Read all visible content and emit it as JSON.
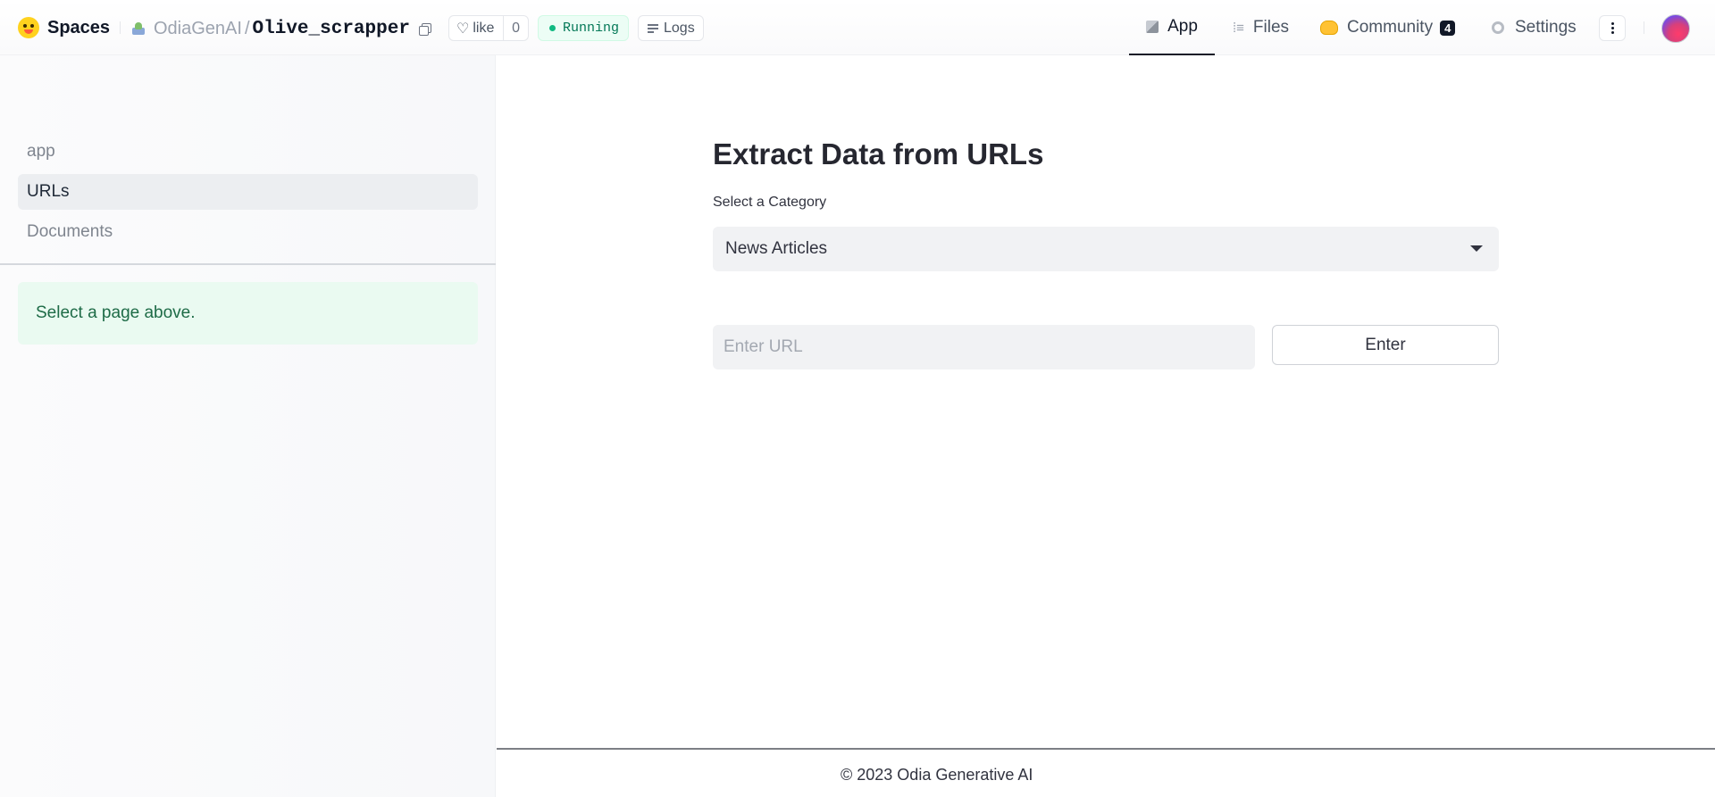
{
  "header": {
    "brand": "Spaces",
    "org": "OdiaGenAI",
    "separator": "/",
    "repo": "Olive_scrapper",
    "like_label": "like",
    "like_count": "0",
    "status": "Running",
    "logs_label": "Logs",
    "tabs": [
      {
        "label": "App",
        "icon": "cube-icon",
        "active": true
      },
      {
        "label": "Files",
        "icon": "files-icon",
        "active": false
      },
      {
        "label": "Community",
        "icon": "hands-icon",
        "badge": "4",
        "active": false
      },
      {
        "label": "Settings",
        "icon": "gear-icon",
        "active": false
      }
    ]
  },
  "sidebar": {
    "items": [
      {
        "label": "app",
        "active": false
      },
      {
        "label": "URLs",
        "active": true
      },
      {
        "label": "Documents",
        "active": false
      }
    ],
    "info": "Select a page above."
  },
  "main": {
    "title": "Extract Data from URLs",
    "category_label": "Select a Category",
    "category_selected": "News Articles",
    "url_placeholder": "Enter URL",
    "url_value": "",
    "enter_label": "Enter"
  },
  "footer": {
    "text": "© 2023 Odia Generative AI"
  },
  "colors": {
    "accent": "#111827",
    "running_bg": "#ecfdf5",
    "running_text": "#047857",
    "info_bg": "#eafaf1"
  }
}
